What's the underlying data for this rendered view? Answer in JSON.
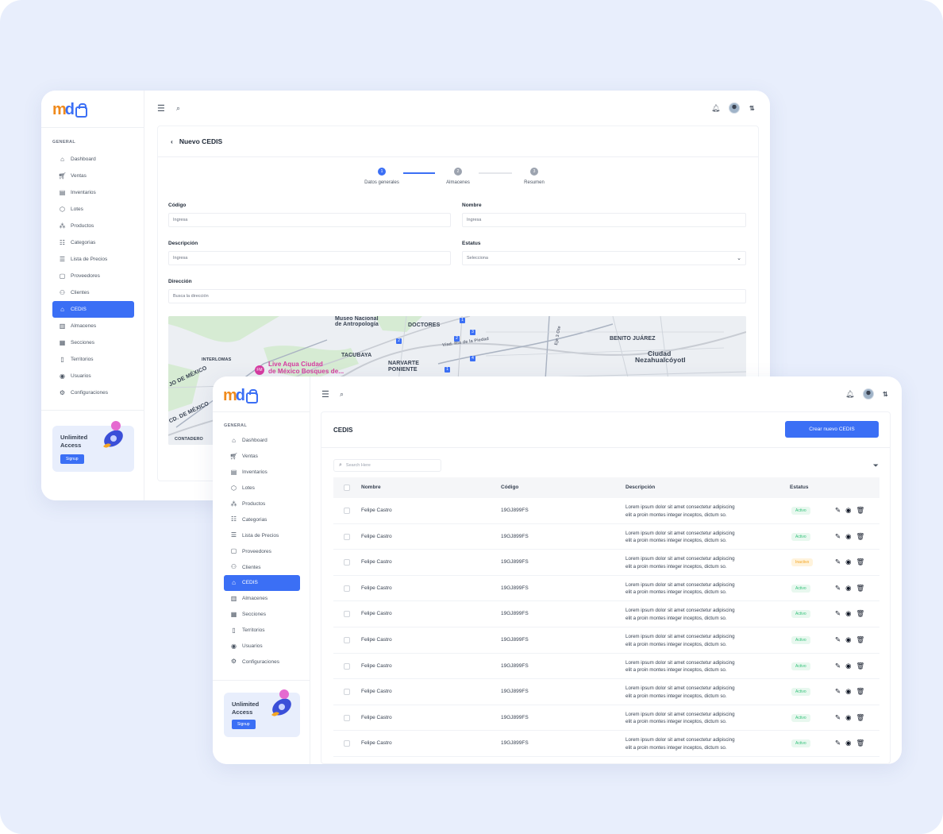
{
  "common": {
    "brand_m": "m",
    "brand_d": "d",
    "section": "GENERAL",
    "nav": [
      {
        "label": "Dashboard",
        "icon": "home-icon"
      },
      {
        "label": "Ventas",
        "icon": "cart-icon"
      },
      {
        "label": "Inventarios",
        "icon": "inventory-icon"
      },
      {
        "label": "Lotes",
        "icon": "box-icon"
      },
      {
        "label": "Productos",
        "icon": "products-icon"
      },
      {
        "label": "Categorias",
        "icon": "categories-icon"
      },
      {
        "label": "Lista de Precios",
        "icon": "price-list-icon"
      },
      {
        "label": "Proveedores",
        "icon": "clipboard-icon"
      },
      {
        "label": "Clientes",
        "icon": "users-icon"
      },
      {
        "label": "CEDIS",
        "icon": "warehouse-icon",
        "active": true
      },
      {
        "label": "Almacenes",
        "icon": "storage-icon"
      },
      {
        "label": "Secciones",
        "icon": "sections-icon"
      },
      {
        "label": "Territorios",
        "icon": "map-icon"
      },
      {
        "label": "Usuarios",
        "icon": "user-circle-icon"
      },
      {
        "label": "Configuraciones",
        "icon": "gear-icon"
      }
    ],
    "promo_title_1": "Unlimited",
    "promo_title_2": "Access",
    "promo_button": "Signup",
    "accent": "#3b6ff5"
  },
  "form": {
    "title": "Nuevo CEDIS",
    "steps": [
      {
        "num": "1",
        "label": "Datos generales"
      },
      {
        "num": "2",
        "label": "Almacenes"
      },
      {
        "num": "3",
        "label": "Resumen"
      }
    ],
    "fields": {
      "codigo_label": "Código",
      "codigo_placeholder": "Ingresa",
      "nombre_label": "Nombre",
      "nombre_placeholder": "Ingresa",
      "descripcion_label": "Descripción",
      "descripcion_placeholder": "Ingresa",
      "estatus_label": "Estatus",
      "estatus_placeholder": "Selecciona",
      "direccion_label": "Dirección",
      "direccion_placeholder": "Busca la dirección"
    },
    "map_labels": {
      "museo_1": "Museo Nacional",
      "museo_2": "de Antropología",
      "doctores": "DOCTORES",
      "tacubaya": "TACUBAYA",
      "interlomas": "INTERLOMAS",
      "live_1": "Live Aqua Ciudad",
      "live_2": "de México Bosques de...",
      "narvarte_1": "NARVARTE",
      "narvarte_2": "PONIENTE",
      "benito": "BENITO JUÁREZ",
      "ciudad_1": "Ciudad",
      "ciudad_2": "Nezahualcóyotl",
      "cdmx_1": "JO DE MÉXICO",
      "cdmx_2": "CD. DE MÉXICO",
      "contadero": "CONTADERO",
      "viaducto": "Viad. Río de la Piedad",
      "eje": "Eje 3 Ote",
      "hotel_badge": "FM"
    }
  },
  "list": {
    "title": "CEDIS",
    "create_button": "Crear nuevo CEDIS",
    "search_placeholder": "Search Here",
    "columns": {
      "nombre": "Nombre",
      "codigo": "Código",
      "descripcion": "Descripción",
      "estatus": "Estatus"
    },
    "rows": [
      {
        "nombre": "Felipe Castro",
        "codigo": "19GJ899FS",
        "desc_1": "Lorem ipsum dolor sit amet consectetur adipiscing",
        "desc_2": "elit a proin montes integer inceptos, dictum so.",
        "estatus": "Activo",
        "active": true
      },
      {
        "nombre": "Felipe Castro",
        "codigo": "19GJ899FS",
        "desc_1": "Lorem ipsum dolor sit amet consectetur adipiscing",
        "desc_2": "elit a proin montes integer inceptos, dictum so.",
        "estatus": "Activo",
        "active": true
      },
      {
        "nombre": "Felipe Castro",
        "codigo": "19GJ899FS",
        "desc_1": "Lorem ipsum dolor sit amet consectetur adipiscing",
        "desc_2": "elit a proin montes integer inceptos, dictum so.",
        "estatus": "Inactivo",
        "active": false
      },
      {
        "nombre": "Felipe Castro",
        "codigo": "19GJ899FS",
        "desc_1": "Lorem ipsum dolor sit amet consectetur adipiscing",
        "desc_2": "elit a proin montes integer inceptos, dictum so.",
        "estatus": "Activo",
        "active": true
      },
      {
        "nombre": "Felipe Castro",
        "codigo": "19GJ899FS",
        "desc_1": "Lorem ipsum dolor sit amet consectetur adipiscing",
        "desc_2": "elit a proin montes integer inceptos, dictum so.",
        "estatus": "Activo",
        "active": true
      },
      {
        "nombre": "Felipe Castro",
        "codigo": "19GJ899FS",
        "desc_1": "Lorem ipsum dolor sit amet consectetur adipiscing",
        "desc_2": "elit a proin montes integer inceptos, dictum so.",
        "estatus": "Activo",
        "active": true
      },
      {
        "nombre": "Felipe Castro",
        "codigo": "19GJ899FS",
        "desc_1": "Lorem ipsum dolor sit amet consectetur adipiscing",
        "desc_2": "elit a proin montes integer inceptos, dictum so.",
        "estatus": "Activo",
        "active": true
      },
      {
        "nombre": "Felipe Castro",
        "codigo": "19GJ899FS",
        "desc_1": "Lorem ipsum dolor sit amet consectetur adipiscing",
        "desc_2": "elit a proin montes integer inceptos, dictum so.",
        "estatus": "Activo",
        "active": true
      },
      {
        "nombre": "Felipe Castro",
        "codigo": "19GJ899FS",
        "desc_1": "Lorem ipsum dolor sit amet consectetur adipiscing",
        "desc_2": "elit a proin montes integer inceptos, dictum so.",
        "estatus": "Activo",
        "active": true
      },
      {
        "nombre": "Felipe Castro",
        "codigo": "19GJ899FS",
        "desc_1": "Lorem ipsum dolor sit amet consectetur adipiscing",
        "desc_2": "elit a proin montes integer inceptos, dictum so.",
        "estatus": "Activo",
        "active": true
      }
    ]
  }
}
